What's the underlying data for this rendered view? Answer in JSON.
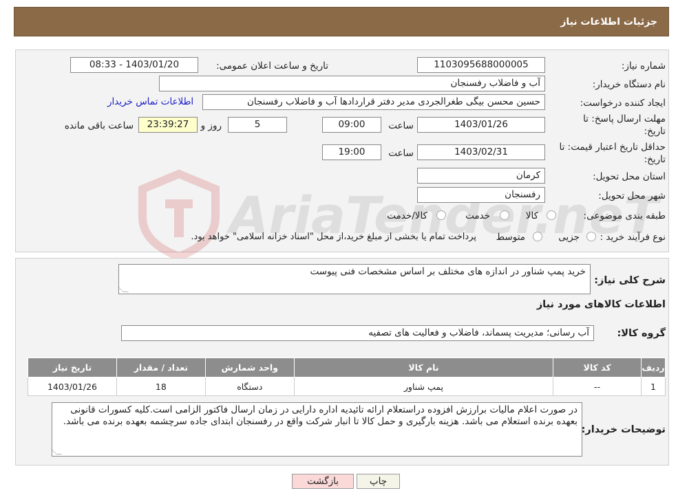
{
  "header": {
    "title": "جزئیات اطلاعات نیاز"
  },
  "watermark": {
    "text": "AriaTender.neT"
  },
  "form": {
    "need_number_label": "شماره نیاز:",
    "need_number": "1103095688000005",
    "announce_label": "تاریخ و ساعت اعلان عمومی:",
    "announce_value": "1403/01/20 - 08:33",
    "buyer_org_label": "نام دستگاه خریدار:",
    "buyer_org": "آب و فاضلاب رفسنجان",
    "creator_label": "ایجاد کننده درخواست:",
    "creator": "حسین محسن بیگی طغرالجردی مدیر دفتر قراردادها آب و فاضلاب رفسنجان",
    "contact_link": "اطلاعات تماس خریدار",
    "deadline_label_1": "مهلت ارسال پاسخ: تا",
    "deadline_label_2": "تاریخ:",
    "deadline_date": "1403/01/26",
    "time_label": "ساعت",
    "deadline_time": "09:00",
    "days_value": "5",
    "days_label": "روز و",
    "remaining_time": "23:39:27",
    "remaining_label": "ساعت باقی مانده",
    "validity_label_1": "حداقل تاریخ اعتبار قیمت: تا",
    "validity_label_2": "تاریخ:",
    "validity_date": "1403/02/31",
    "validity_time": "19:00",
    "province_label": "استان محل تحویل:",
    "province": "کرمان",
    "city_label": "شهر محل تحویل:",
    "city": "رفسنجان",
    "category_label": "طبقه بندی موضوعی:",
    "category_options": [
      "کالا",
      "خدمت",
      "کالا/خدمت"
    ],
    "purchase_type_label": "نوع فرآیند خرید :",
    "purchase_options": [
      "جزیی",
      "متوسط"
    ],
    "purchase_note": "پرداخت تمام یا بخشی از مبلغ خرید،از محل \"اسناد خزانه اسلامی\" خواهد بود."
  },
  "details": {
    "summary_label": "شرح کلی نیاز:",
    "summary": "خرید پمپ شناور در اندازه های مختلف بر اساس مشخصات فنی پیوست",
    "goods_info_title": "اطلاعات کالاهای مورد نیاز",
    "group_label": "گروه کالا:",
    "group_value": "آب رسانی؛ مدیریت پسماند، فاضلاب و فعالیت های تصفیه",
    "table": {
      "headers": [
        "ردیف",
        "کد کالا",
        "نام کالا",
        "واحد شمارش",
        "تعداد / مقدار",
        "تاریخ نیاز"
      ],
      "rows": [
        [
          "1",
          "--",
          "پمپ شناور",
          "دستگاه",
          "18",
          "1403/01/26"
        ]
      ]
    },
    "buyer_notes_label": "توضیحات خریدار:",
    "buyer_notes": "در صورت اعلام مالیات برارزش افزوده دراستعلام ارائه تائیدیه اداره دارایی در زمان ارسال فاکتور الزامی است.کلیه کسورات قانونی بعهده برنده استعلام می باشد. هزینه بارگیری و حمل کالا تا انبار شرکت واقع در رفسنجان ابتدای جاده سرچشمه بعهده برنده می باشد."
  },
  "buttons": {
    "print": "چاپ",
    "back": "بازگشت"
  }
}
